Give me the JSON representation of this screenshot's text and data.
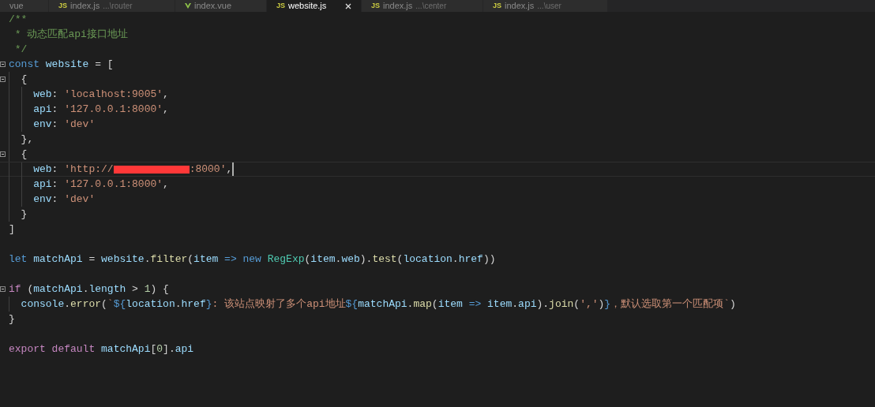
{
  "tabs": [
    {
      "label": "vue",
      "kind": "plain",
      "selected": false
    },
    {
      "label": "index.js",
      "path": "...\\router",
      "kind": "js",
      "icon_text": "JS",
      "selected": false
    },
    {
      "label": "index.vue",
      "kind": "vue",
      "selected": false
    },
    {
      "label": "website.js",
      "kind": "js",
      "icon_text": "JS",
      "selected": true
    },
    {
      "label": "index.js",
      "path": "...\\center",
      "kind": "js",
      "icon_text": "JS",
      "selected": false
    },
    {
      "label": "index.js",
      "path": "...\\user",
      "kind": "js",
      "icon_text": "JS",
      "selected": false
    }
  ],
  "code": [
    {
      "fold": false,
      "current": false,
      "tokens": [
        {
          "kind": "comment",
          "text": "/**"
        }
      ]
    },
    {
      "fold": false,
      "current": false,
      "tokens": [
        {
          "kind": "comment",
          "text": " * 动态匹配api接口地址"
        }
      ]
    },
    {
      "fold": false,
      "current": false,
      "tokens": [
        {
          "kind": "comment",
          "text": " */"
        }
      ]
    },
    {
      "fold": true,
      "current": false,
      "tokens": [
        {
          "kind": "keyword",
          "text": "const "
        },
        {
          "kind": "variable",
          "text": "website"
        },
        {
          "kind": "plain",
          "text": " = ["
        }
      ]
    },
    {
      "fold": true,
      "current": false,
      "tokens": [
        {
          "kind": "plain",
          "text": "  {"
        }
      ]
    },
    {
      "fold": false,
      "current": false,
      "tokens": [
        {
          "kind": "variable",
          "text": "    web"
        },
        {
          "kind": "plain",
          "text": ": "
        },
        {
          "kind": "string",
          "text": "'localhost:9005'"
        },
        {
          "kind": "plain",
          "text": ","
        }
      ]
    },
    {
      "fold": false,
      "current": false,
      "tokens": [
        {
          "kind": "variable",
          "text": "    api"
        },
        {
          "kind": "plain",
          "text": ": "
        },
        {
          "kind": "string",
          "text": "'127.0.0.1:8000'"
        },
        {
          "kind": "plain",
          "text": ","
        }
      ]
    },
    {
      "fold": false,
      "current": false,
      "tokens": [
        {
          "kind": "variable",
          "text": "    env"
        },
        {
          "kind": "plain",
          "text": ": "
        },
        {
          "kind": "string",
          "text": "'dev'"
        }
      ]
    },
    {
      "fold": false,
      "current": false,
      "tokens": [
        {
          "kind": "plain",
          "text": "  },"
        }
      ]
    },
    {
      "fold": true,
      "current": false,
      "tokens": [
        {
          "kind": "plain",
          "text": "  {"
        }
      ]
    },
    {
      "fold": false,
      "current": true,
      "tokens": [
        {
          "kind": "variable",
          "text": "    web"
        },
        {
          "kind": "plain",
          "text": ": "
        },
        {
          "kind": "string",
          "text": "'http://"
        },
        {
          "kind": "redaction"
        },
        {
          "kind": "string",
          "text": ":8000'"
        },
        {
          "kind": "plain",
          "text": ","
        }
      ]
    },
    {
      "fold": false,
      "current": false,
      "tokens": [
        {
          "kind": "variable",
          "text": "    api"
        },
        {
          "kind": "plain",
          "text": ": "
        },
        {
          "kind": "string",
          "text": "'127.0.0.1:8000'"
        },
        {
          "kind": "plain",
          "text": ","
        }
      ]
    },
    {
      "fold": false,
      "current": false,
      "tokens": [
        {
          "kind": "variable",
          "text": "    env"
        },
        {
          "kind": "plain",
          "text": ": "
        },
        {
          "kind": "string",
          "text": "'dev'"
        }
      ]
    },
    {
      "fold": false,
      "current": false,
      "tokens": [
        {
          "kind": "plain",
          "text": "  }"
        }
      ]
    },
    {
      "fold": false,
      "current": false,
      "tokens": [
        {
          "kind": "plain",
          "text": "]"
        }
      ]
    },
    {
      "fold": false,
      "current": false
    },
    {
      "fold": false,
      "current": false,
      "tokens": [
        {
          "kind": "keyword",
          "text": "let "
        },
        {
          "kind": "variable",
          "text": "matchApi"
        },
        {
          "kind": "plain",
          "text": " = "
        },
        {
          "kind": "variable",
          "text": "website"
        },
        {
          "kind": "plain",
          "text": "."
        },
        {
          "kind": "function",
          "text": "filter"
        },
        {
          "kind": "plain",
          "text": "("
        },
        {
          "kind": "variable",
          "text": "item "
        },
        {
          "kind": "keyword",
          "text": "=> new "
        },
        {
          "kind": "class",
          "text": "RegExp"
        },
        {
          "kind": "plain",
          "text": "("
        },
        {
          "kind": "variable",
          "text": "item"
        },
        {
          "kind": "plain",
          "text": "."
        },
        {
          "kind": "variable",
          "text": "web"
        },
        {
          "kind": "plain",
          "text": ")."
        },
        {
          "kind": "function",
          "text": "test"
        },
        {
          "kind": "plain",
          "text": "("
        },
        {
          "kind": "variable",
          "text": "location"
        },
        {
          "kind": "plain",
          "text": "."
        },
        {
          "kind": "variable",
          "text": "href"
        },
        {
          "kind": "plain",
          "text": "))"
        }
      ]
    },
    {
      "fold": false,
      "current": false
    },
    {
      "fold": true,
      "current": false,
      "tokens": [
        {
          "kind": "control",
          "text": "if"
        },
        {
          "kind": "plain",
          "text": " ("
        },
        {
          "kind": "variable",
          "text": "matchApi"
        },
        {
          "kind": "plain",
          "text": "."
        },
        {
          "kind": "variable",
          "text": "length"
        },
        {
          "kind": "plain",
          "text": " > "
        },
        {
          "kind": "number",
          "text": "1"
        },
        {
          "kind": "plain",
          "text": ") {"
        }
      ]
    },
    {
      "fold": false,
      "current": false,
      "tokens": [
        {
          "kind": "variable",
          "text": "  console"
        },
        {
          "kind": "plain",
          "text": "."
        },
        {
          "kind": "function",
          "text": "error"
        },
        {
          "kind": "plain",
          "text": "("
        },
        {
          "kind": "string",
          "text": "`"
        },
        {
          "kind": "keyword",
          "text": "${"
        },
        {
          "kind": "variable",
          "text": "location"
        },
        {
          "kind": "plain",
          "text": "."
        },
        {
          "kind": "variable",
          "text": "href"
        },
        {
          "kind": "keyword",
          "text": "}"
        },
        {
          "kind": "string",
          "text": ": 该站点映射了多个api地址"
        },
        {
          "kind": "keyword",
          "text": "${"
        },
        {
          "kind": "variable",
          "text": "matchApi"
        },
        {
          "kind": "plain",
          "text": "."
        },
        {
          "kind": "function",
          "text": "map"
        },
        {
          "kind": "plain",
          "text": "("
        },
        {
          "kind": "variable",
          "text": "item "
        },
        {
          "kind": "keyword",
          "text": "=> "
        },
        {
          "kind": "variable",
          "text": "item"
        },
        {
          "kind": "plain",
          "text": "."
        },
        {
          "kind": "variable",
          "text": "api"
        },
        {
          "kind": "plain",
          "text": ")."
        },
        {
          "kind": "function",
          "text": "join"
        },
        {
          "kind": "plain",
          "text": "("
        },
        {
          "kind": "string",
          "text": "','"
        },
        {
          "kind": "plain",
          "text": ")"
        },
        {
          "kind": "keyword",
          "text": "}"
        },
        {
          "kind": "string",
          "text": "，默认选取第一个匹配项`"
        },
        {
          "kind": "plain",
          "text": ")"
        }
      ]
    },
    {
      "fold": false,
      "current": false,
      "tokens": [
        {
          "kind": "plain",
          "text": "}"
        }
      ]
    },
    {
      "fold": false,
      "current": false
    },
    {
      "fold": false,
      "current": false,
      "tokens": [
        {
          "kind": "control",
          "text": "export default "
        },
        {
          "kind": "variable",
          "text": "matchApi"
        },
        {
          "kind": "plain",
          "text": "["
        },
        {
          "kind": "number",
          "text": "0"
        },
        {
          "kind": "plain",
          "text": "]."
        },
        {
          "kind": "variable",
          "text": "api"
        }
      ]
    }
  ]
}
